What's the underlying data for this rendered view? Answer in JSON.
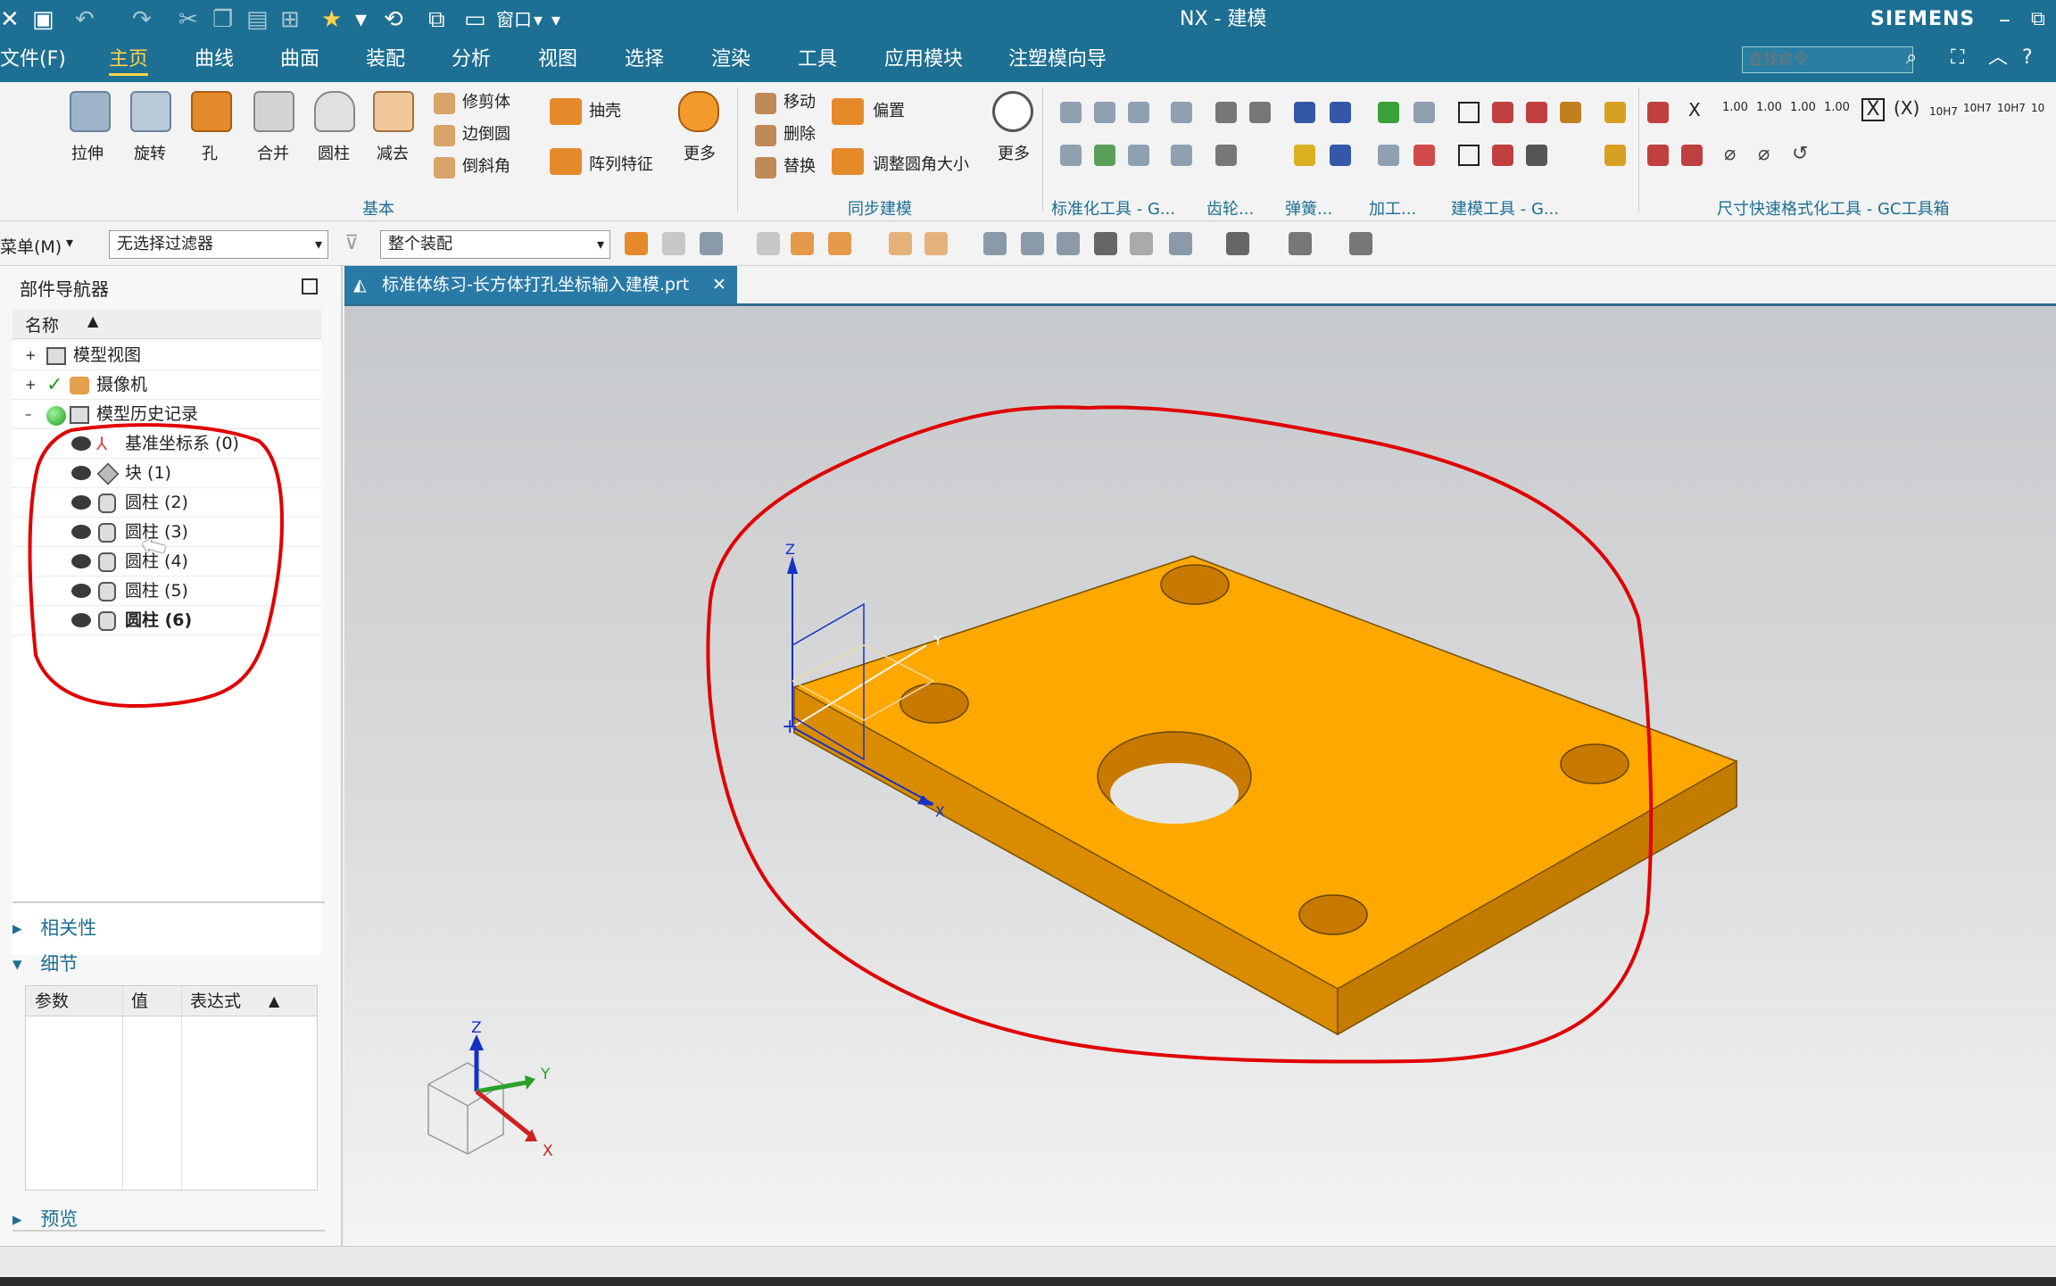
{
  "window": {
    "app_title": "NX - 建模",
    "brand": "SIEMENS"
  },
  "menu": {
    "file": "文件(F)",
    "tabs": [
      "主页",
      "曲线",
      "曲面",
      "装配",
      "分析",
      "视图",
      "选择",
      "渲染",
      "工具",
      "应用模块",
      "注塑模向导"
    ],
    "active_tab": "主页",
    "search_placeholder": "查找命令",
    "window_label": "窗口"
  },
  "ribbon": {
    "basic": {
      "buttons": [
        "拉伸",
        "旋转",
        "孔",
        "合并",
        "圆柱",
        "减去"
      ],
      "small": [
        "修剪体",
        "边倒圆",
        "倒斜角",
        "抽壳",
        "阵列特征",
        "更多"
      ],
      "group_label": "基本"
    },
    "sync": {
      "small": [
        "移动",
        "删除",
        "替换",
        "偏置",
        "调整圆角大小",
        "更多"
      ],
      "group_label": "同步建模"
    },
    "groups": [
      "标准化工具 - G...",
      "齿轮...",
      "弹簧...",
      "加工...",
      "建模工具 - G...",
      "尺寸快速格式化工具 - GC工具箱"
    ],
    "dim_labels": [
      "1.00",
      "1.00",
      "1.00",
      "1.00",
      "10H7",
      "10H7",
      "10H7",
      "10"
    ]
  },
  "selection_bar": {
    "menu": "菜单(M)",
    "filter": "无选择过滤器",
    "scope": "整个装配"
  },
  "navigator": {
    "title": "部件导航器",
    "column_name": "名称",
    "nodes": [
      {
        "label": "模型视图",
        "level": 0
      },
      {
        "label": "摄像机",
        "level": 0
      },
      {
        "label": "模型历史记录",
        "level": 0
      }
    ],
    "features": [
      "基准坐标系 (0)",
      "块 (1)",
      "圆柱 (2)",
      "圆柱 (3)",
      "圆柱 (4)",
      "圆柱 (5)",
      "圆柱 (6)"
    ],
    "dependencies": "相关性",
    "details": "细节",
    "details_columns": [
      "参数",
      "值",
      "表达式"
    ],
    "preview": "预览"
  },
  "document": {
    "tab_title": "标准体练习-长方体打孔坐标输入建模.prt"
  },
  "viewport": {
    "axis_x": "X",
    "axis_y": "Y",
    "axis_z": "Z",
    "part_color": "#ffa500",
    "annotation_color": "#e00000"
  }
}
